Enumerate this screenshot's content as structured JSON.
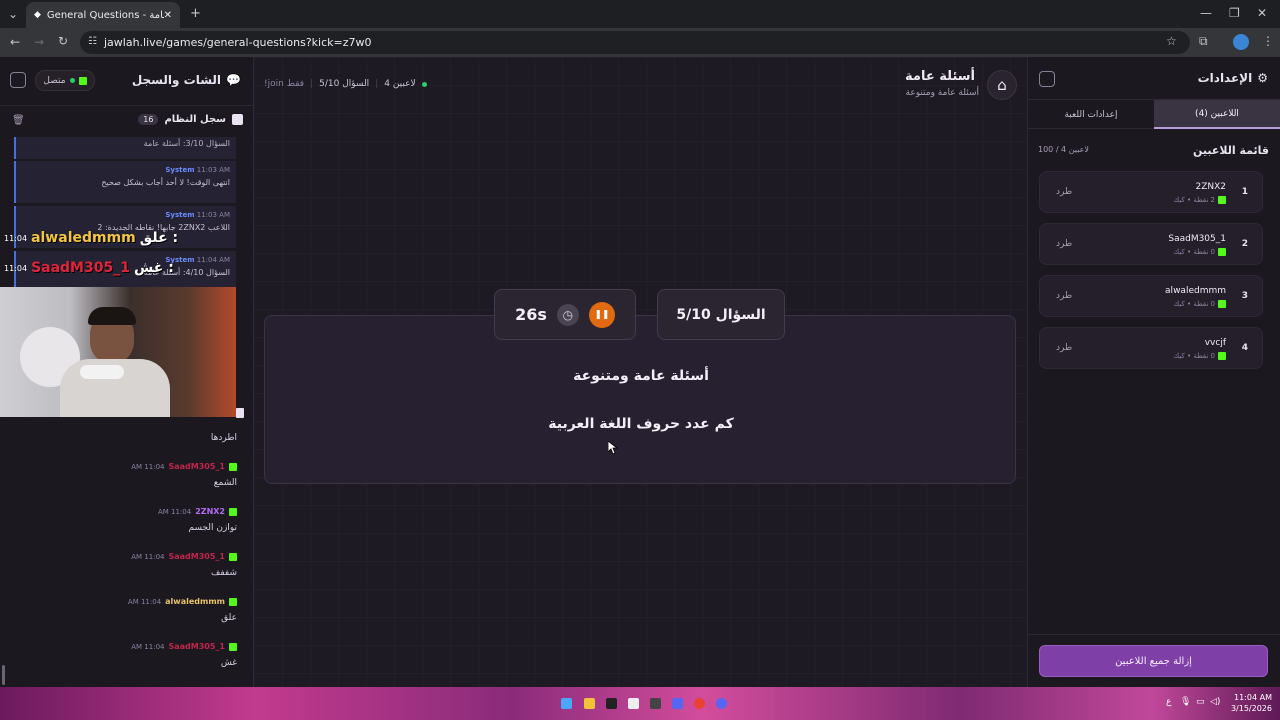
{
  "browser": {
    "tab_title": "General Questions - أسئلة عامة",
    "url": "jawlah.live/games/general-questions?kick=z7w0"
  },
  "chat": {
    "title": "الشات والسجل",
    "status": "متصل",
    "syslog_title": "سجل النظام",
    "syslog_count": "16",
    "system_messages": [
      {
        "text": "السؤال 3/10: أسئلة عامة"
      },
      {
        "sender": "System",
        "time": "11:03 AM",
        "text": "انتهى الوقت! لا أحد أجاب بشكل صحيح"
      },
      {
        "sender": "System",
        "time": "11:03 AM",
        "text": "اللاعب 2ZNX2 جابها! نقاطه الجديدة: 2"
      },
      {
        "sender": "System",
        "time": "11:04 AM",
        "text": "السؤال 4/10: أسئلة عامة"
      }
    ],
    "overlay": [
      {
        "time": "11:04",
        "name": "alwaledmmm",
        "msg": "علق :"
      },
      {
        "time": "11:04",
        "name": "SaadM305_1",
        "msg": "غش :"
      }
    ],
    "first_line": "اطردها",
    "messages": [
      {
        "name": "SaadM305_1",
        "time": "11:04 AM",
        "text": "الشمع",
        "color": "#c0264a"
      },
      {
        "name": "2ZNX2",
        "time": "11:04 AM",
        "text": "توازن الجسم",
        "color": "#b36cf0"
      },
      {
        "name": "SaadM305_1",
        "time": "11:04 AM",
        "text": "شففف",
        "color": "#c0264a"
      },
      {
        "name": "alwaledmmm",
        "time": "11:04 AM",
        "text": "علق",
        "color": "#e6c36a"
      },
      {
        "name": "SaadM305_1",
        "time": "11:04 AM",
        "text": "غش",
        "color": "#c0264a"
      }
    ]
  },
  "header": {
    "title": "أسئلة عامة",
    "subtitle": "أسئلة عامة ومتنوعة",
    "players_count": "4 لاعبين",
    "question_progress": "السؤال 5/10",
    "join_hint": "!join فقط"
  },
  "game": {
    "timer": "26s",
    "question_label": "السؤال 5/10",
    "category": "أسئلة عامة ومتنوعة",
    "question": "كم عدد حروف اللغة العربية"
  },
  "settings": {
    "title": "الإعدادات",
    "tabs": [
      "اللاعبين (4)",
      "إعدادات اللعبة"
    ],
    "players_title": "قائمة اللاعبين",
    "players_capacity": "100 / 4 لاعبين",
    "kick_label": "طرد",
    "players": [
      {
        "rank": "1",
        "name": "2ZNX2",
        "meta": "2 نقطة • كيك"
      },
      {
        "rank": "2",
        "name": "SaadM305_1",
        "meta": "0 نقطة • كيك"
      },
      {
        "rank": "3",
        "name": "alwaledmmm",
        "meta": "0 نقطة • كيك"
      },
      {
        "rank": "4",
        "name": "vvcjf",
        "meta": "0 نقطة • كيك"
      }
    ],
    "remove_all": "إزالة جميع اللاعبين"
  },
  "taskbar": {
    "time": "11:04 AM",
    "date": "3/15/2026",
    "lang": "ع"
  },
  "colors": {
    "accent_purple": "#7e3fa6",
    "kick_green": "#53fc18",
    "timer_orange": "#e06a10",
    "online_green": "#2ecc71"
  }
}
